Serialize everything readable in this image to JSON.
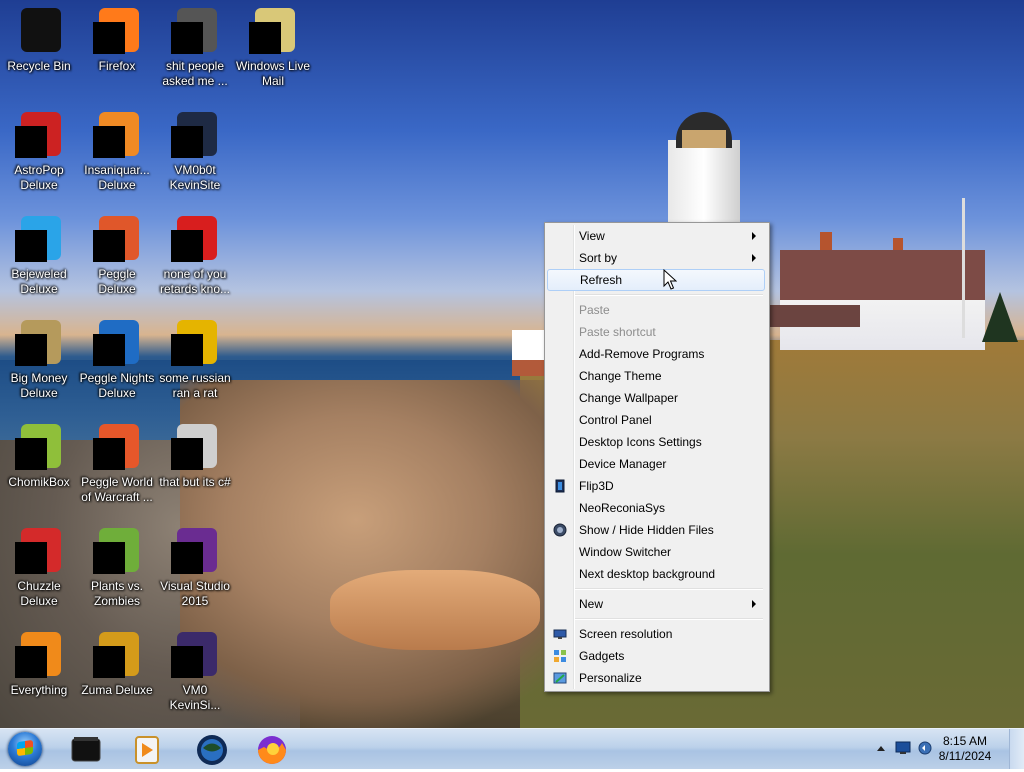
{
  "desktop_icons": [
    {
      "id": "recycle-bin",
      "label": "Recycle Bin",
      "color": "#111111"
    },
    {
      "id": "firefox",
      "label": "Firefox",
      "color": "#ff7a1a"
    },
    {
      "id": "folder-1",
      "label": "shit people\nasked me ...",
      "color": "#555555"
    },
    {
      "id": "windows-live-mail",
      "label": "Windows Live\nMail",
      "color": "#d9c878"
    },
    {
      "id": "astropop",
      "label": "AstroPop\nDeluxe",
      "color": "#cc2222"
    },
    {
      "id": "insaniquarium",
      "label": "Insaniquar...\nDeluxe",
      "color": "#f08a24"
    },
    {
      "id": "vm0b0t",
      "label": "VM0b0t\nKevinSite",
      "color": "#1e2a44"
    },
    {
      "id": "bejeweled",
      "label": "Bejeweled\nDeluxe",
      "color": "#2aa4e8"
    },
    {
      "id": "peggle",
      "label": "Peggle Deluxe",
      "color": "#e0572a"
    },
    {
      "id": "none-of-you",
      "label": "none of you\nretards kno...",
      "color": "#d81e1e"
    },
    {
      "id": "big-money",
      "label": "Big Money\nDeluxe",
      "color": "#b59a5c"
    },
    {
      "id": "peggle-nights",
      "label": "Peggle Nights\nDeluxe",
      "color": "#1f6cc4"
    },
    {
      "id": "russian-rat",
      "label": "some russian\nran a rat",
      "color": "#e5b400"
    },
    {
      "id": "chomikbox",
      "label": "ChomikBox",
      "color": "#8fbf3a"
    },
    {
      "id": "peggle-wow",
      "label": "Peggle World\nof Warcraft ...",
      "color": "#e6572a"
    },
    {
      "id": "that-but-csharp",
      "label": "that but its c#",
      "color": "#cfcfcf"
    },
    {
      "id": "chuzzle",
      "label": "Chuzzle\nDeluxe",
      "color": "#d42a2a"
    },
    {
      "id": "plants-vs-zombies",
      "label": "Plants vs.\nZombies",
      "color": "#6fae3a"
    },
    {
      "id": "visual-studio",
      "label": "Visual Studio\n2015",
      "color": "#6a2c91"
    },
    {
      "id": "everything",
      "label": "Everything",
      "color": "#f08a1a"
    },
    {
      "id": "zuma",
      "label": "Zuma Deluxe",
      "color": "#d49b1a"
    },
    {
      "id": "vm0-kevinsite",
      "label": "VM0\nKevinSi...",
      "color": "#3b2a6a"
    }
  ],
  "context_menu": {
    "items": [
      {
        "label": "View",
        "submenu": true
      },
      {
        "label": "Sort by",
        "submenu": true
      },
      {
        "label": "Refresh",
        "hover": true
      },
      {
        "label": "Paste",
        "disabled": true
      },
      {
        "label": "Paste shortcut",
        "disabled": true
      },
      {
        "label": "Add-Remove Programs"
      },
      {
        "label": "Change Theme"
      },
      {
        "label": "Change Wallpaper"
      },
      {
        "label": "Control Panel"
      },
      {
        "label": "Desktop Icons Settings"
      },
      {
        "label": "Device Manager"
      },
      {
        "label": "Flip3D",
        "icon": "flip3d-icon"
      },
      {
        "label": "NeoReconiaSys"
      },
      {
        "label": "Show / Hide Hidden Files",
        "icon": "hidden-files-icon"
      },
      {
        "label": "Window Switcher"
      },
      {
        "label": "Next desktop background"
      },
      {
        "label": "New",
        "submenu": true
      },
      {
        "label": "Screen resolution",
        "icon": "screen-resolution-icon"
      },
      {
        "label": "Gadgets",
        "icon": "gadgets-icon"
      },
      {
        "label": "Personalize",
        "icon": "personalize-icon"
      }
    ]
  },
  "taskbar": {
    "pinned": [
      {
        "id": "taskbar-app-black",
        "icon": "black-box-icon"
      },
      {
        "id": "taskbar-media-player",
        "icon": "media-player-icon"
      },
      {
        "id": "taskbar-globe",
        "icon": "globe-icon"
      },
      {
        "id": "taskbar-firefox",
        "icon": "firefox-icon"
      }
    ],
    "clock": {
      "time": "8:15 AM",
      "date": "8/11/2024"
    }
  }
}
